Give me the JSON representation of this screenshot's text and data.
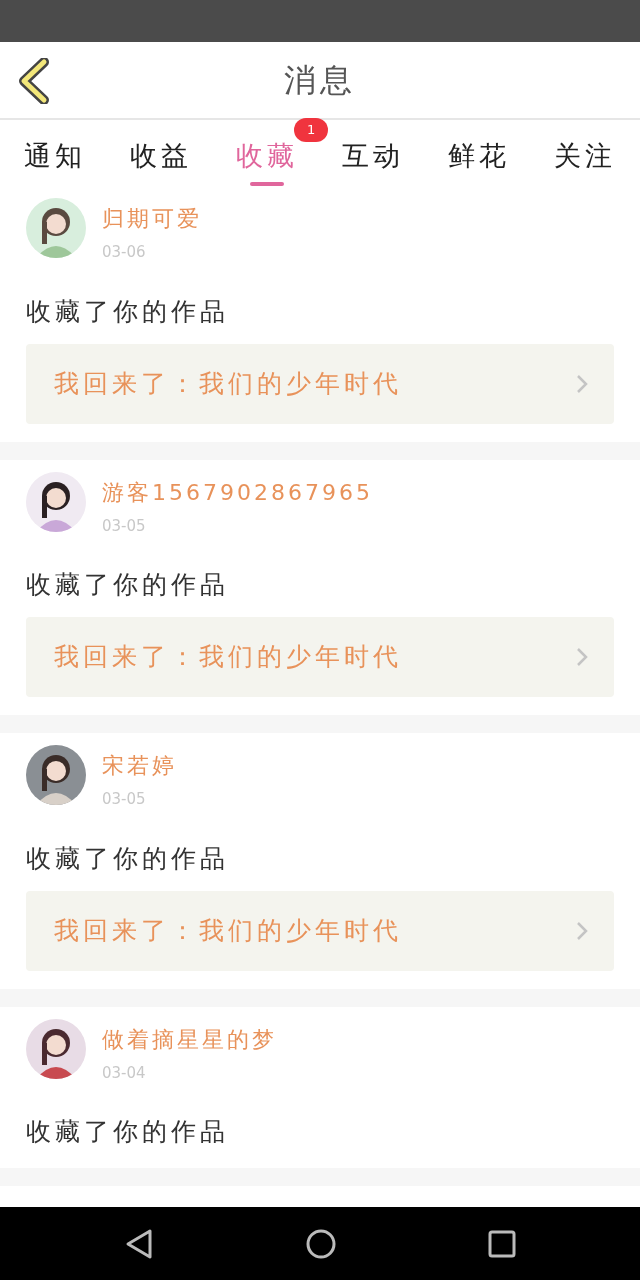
{
  "header": {
    "title": "消息"
  },
  "tabs": [
    {
      "label": "通知",
      "selected": false
    },
    {
      "label": "收益",
      "selected": false
    },
    {
      "label": "收藏",
      "selected": true,
      "badge": "1"
    },
    {
      "label": "互动",
      "selected": false
    },
    {
      "label": "鲜花",
      "selected": false
    },
    {
      "label": "关注",
      "selected": false
    }
  ],
  "messages": [
    {
      "user": "归期可爱",
      "date": "03-06",
      "action": "收藏了你的作品",
      "work": "我回来了：我们的少年时代"
    },
    {
      "user": "游客1567902867965",
      "date": "03-05",
      "action": "收藏了你的作品",
      "work": "我回来了：我们的少年时代"
    },
    {
      "user": "宋若婷",
      "date": "03-05",
      "action": "收藏了你的作品",
      "work": "我回来了：我们的少年时代"
    },
    {
      "user": "做着摘星星的梦",
      "date": "03-04",
      "action": "收藏了你的作品"
    }
  ]
}
